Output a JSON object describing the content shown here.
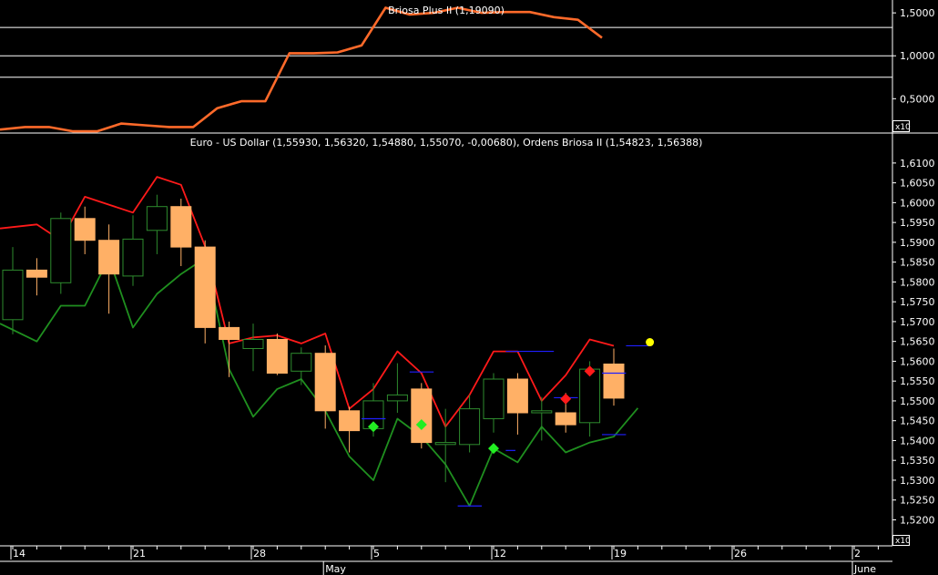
{
  "chart_data": [
    {
      "type": "line",
      "title": "Briosa Plus II (1,19090)",
      "multiplier_label": "x10",
      "y_ticks": [
        "1,5000",
        "1,0000",
        "0,5000"
      ],
      "y_tick_values": [
        1.5,
        1.0,
        0.5
      ],
      "ylim": [
        0.1,
        1.65
      ],
      "reference_lines": [
        1.33,
        1.0,
        0.75
      ],
      "colors": {
        "line": "#ff6a2a",
        "reference": "#ffffff"
      },
      "series": [
        {
          "values": [
            0.14,
            0.17,
            0.17,
            0.12,
            0.12,
            0.21,
            0.19,
            0.17,
            0.17,
            0.39,
            0.47,
            0.47,
            1.03,
            1.03,
            1.04,
            1.12,
            1.56,
            1.48,
            1.5,
            1.56,
            1.5,
            1.51,
            1.51,
            1.45,
            1.42,
            1.21
          ]
        }
      ]
    },
    {
      "type": "candlestick",
      "title": "Euro - US Dollar (1,55930, 1,56320, 1,54880, 1,55070, -0,00680), Ordens Briosa II (1,54823, 1,56388)",
      "multiplier_label": "x10",
      "ylim": [
        1.5185,
        1.6125
      ],
      "y_ticks": [
        "1,6100",
        "1,6050",
        "1,6000",
        "1,5950",
        "1,5900",
        "1,5850",
        "1,5800",
        "1,5750",
        "1,5700",
        "1,5650",
        "1,5600",
        "1,5550",
        "1,5500",
        "1,5450",
        "1,5400",
        "1,5350",
        "1,5300",
        "1,5250",
        "1,5200"
      ],
      "y_tick_values": [
        1.61,
        1.605,
        1.6,
        1.595,
        1.59,
        1.585,
        1.58,
        1.575,
        1.57,
        1.565,
        1.56,
        1.555,
        1.55,
        1.545,
        1.54,
        1.535,
        1.53,
        1.525,
        1.52
      ],
      "x_day_labels": [
        {
          "label": "14",
          "index": 0
        },
        {
          "label": "21",
          "index": 5
        },
        {
          "label": "28",
          "index": 10
        },
        {
          "label": "5",
          "index": 15
        },
        {
          "label": "12",
          "index": 20
        },
        {
          "label": "19",
          "index": 25
        },
        {
          "label": "26",
          "index": 30
        },
        {
          "label": "2",
          "index": 35
        }
      ],
      "x_month_labels": [
        {
          "label": "May",
          "index": 13
        },
        {
          "label": "June",
          "index": 35
        }
      ],
      "colors": {
        "down_fill": "#ffb066",
        "up_outline": "#2e8b2e",
        "upper_band": "#ff1a1a",
        "lower_band": "#1f8f1f",
        "level": "#1f1fff",
        "buy_marker": "#22ee22",
        "sell_marker": "#ff1a1a",
        "last_marker": "#ffff00"
      },
      "candles": [
        {
          "open": 1.5705,
          "high": 1.5888,
          "low": 1.5668,
          "close": 1.583
        },
        {
          "open": 1.583,
          "high": 1.586,
          "low": 1.5766,
          "close": 1.5812
        },
        {
          "open": 1.5798,
          "high": 1.5975,
          "low": 1.577,
          "close": 1.596
        },
        {
          "open": 1.596,
          "high": 1.599,
          "low": 1.587,
          "close": 1.5905
        },
        {
          "open": 1.5905,
          "high": 1.5945,
          "low": 1.572,
          "close": 1.582
        },
        {
          "open": 1.5815,
          "high": 1.5968,
          "low": 1.579,
          "close": 1.5908
        },
        {
          "open": 1.593,
          "high": 1.602,
          "low": 1.587,
          "close": 1.599
        },
        {
          "open": 1.599,
          "high": 1.601,
          "low": 1.584,
          "close": 1.5888
        },
        {
          "open": 1.5888,
          "high": 1.5905,
          "low": 1.5645,
          "close": 1.5685
        },
        {
          "open": 1.5685,
          "high": 1.57,
          "low": 1.556,
          "close": 1.5655
        },
        {
          "open": 1.5632,
          "high": 1.5695,
          "low": 1.5575,
          "close": 1.5655
        },
        {
          "open": 1.5655,
          "high": 1.567,
          "low": 1.5565,
          "close": 1.557
        },
        {
          "open": 1.5575,
          "high": 1.5635,
          "low": 1.554,
          "close": 1.562
        },
        {
          "open": 1.562,
          "high": 1.564,
          "low": 1.543,
          "close": 1.5475
        },
        {
          "open": 1.5475,
          "high": 1.5485,
          "low": 1.537,
          "close": 1.5425
        },
        {
          "open": 1.543,
          "high": 1.5545,
          "low": 1.541,
          "close": 1.55
        },
        {
          "open": 1.55,
          "high": 1.5595,
          "low": 1.547,
          "close": 1.5515
        },
        {
          "open": 1.553,
          "high": 1.5545,
          "low": 1.538,
          "close": 1.5395
        },
        {
          "open": 1.539,
          "high": 1.548,
          "low": 1.5295,
          "close": 1.5395
        },
        {
          "open": 1.539,
          "high": 1.5515,
          "low": 1.537,
          "close": 1.548
        },
        {
          "open": 1.5455,
          "high": 1.557,
          "low": 1.542,
          "close": 1.5555
        },
        {
          "open": 1.5555,
          "high": 1.557,
          "low": 1.5415,
          "close": 1.547
        },
        {
          "open": 1.547,
          "high": 1.551,
          "low": 1.54,
          "close": 1.5475
        },
        {
          "open": 1.547,
          "high": 1.552,
          "low": 1.542,
          "close": 1.544
        },
        {
          "open": 1.5445,
          "high": 1.56,
          "low": 1.541,
          "close": 1.558
        },
        {
          "open": 1.5593,
          "high": 1.5632,
          "low": 1.5488,
          "close": 1.5507
        }
      ],
      "upper_band": [
        1.5935,
        1.5945,
        1.5905,
        1.6015,
        1.5995,
        1.5975,
        1.6065,
        1.6045,
        1.589,
        1.5645,
        1.566,
        1.5665,
        1.5645,
        1.567,
        1.548,
        1.553,
        1.5625,
        1.557,
        1.5435,
        1.5515,
        1.5625,
        1.5625,
        1.55,
        1.5565,
        1.5655,
        1.5639
      ],
      "lower_band": [
        1.5695,
        1.565,
        1.574,
        1.574,
        1.586,
        1.5685,
        1.577,
        1.582,
        1.586,
        1.558,
        1.546,
        1.553,
        1.5555,
        1.5475,
        1.536,
        1.53,
        1.5455,
        1.541,
        1.534,
        1.5235,
        1.538,
        1.5345,
        1.5435,
        1.537,
        1.5395,
        1.541,
        1.5482
      ],
      "levels": [
        {
          "value": 1.5455,
          "from": 15,
          "to": 16
        },
        {
          "value": 1.5573,
          "from": 17,
          "to": 18
        },
        {
          "value": 1.5235,
          "from": 19,
          "to": 20
        },
        {
          "value": 1.5375,
          "from": 21,
          "to": 21.4
        },
        {
          "value": 1.5625,
          "from": 21,
          "to": 23
        },
        {
          "value": 1.5508,
          "from": 23,
          "to": 24
        },
        {
          "value": 1.5415,
          "from": 25,
          "to": 26
        },
        {
          "value": 1.557,
          "from": 25,
          "to": 26
        },
        {
          "value": 1.5639,
          "from": 26,
          "to": 27
        }
      ],
      "markers": [
        {
          "kind": "buy",
          "index": 15,
          "value": 1.5435
        },
        {
          "kind": "buy",
          "index": 17,
          "value": 1.544
        },
        {
          "kind": "buy",
          "index": 20,
          "value": 1.538
        },
        {
          "kind": "sell",
          "index": 23,
          "value": 1.5505
        },
        {
          "kind": "sell",
          "index": 24,
          "value": 1.5575
        },
        {
          "kind": "last",
          "index": 26.5,
          "value": 1.5648
        }
      ]
    }
  ]
}
